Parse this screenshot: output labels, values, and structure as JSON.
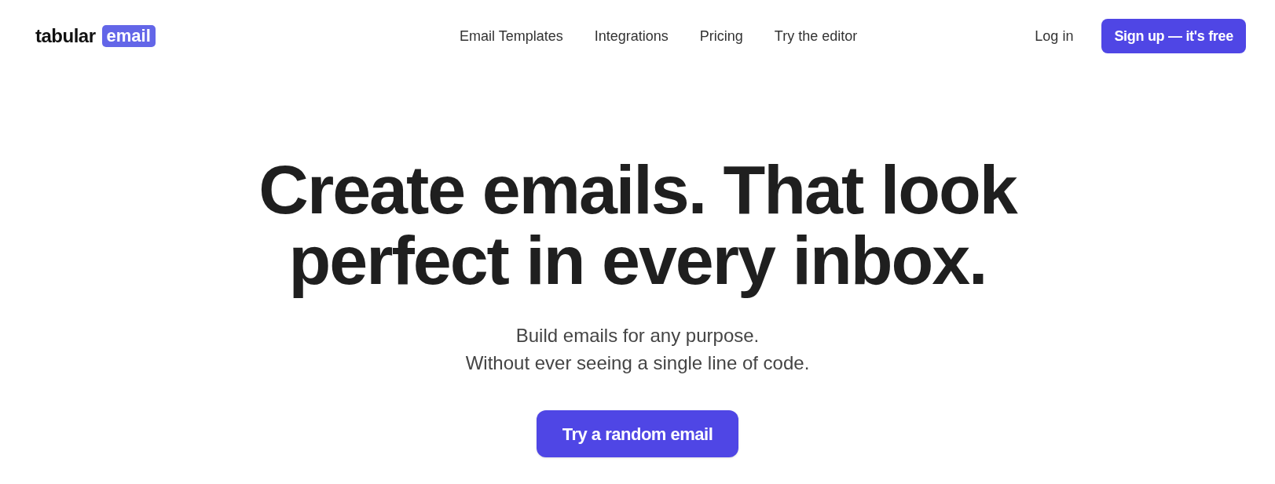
{
  "header": {
    "logo": {
      "word": "tabular",
      "badge": "email"
    },
    "nav": [
      "Email Templates",
      "Integrations",
      "Pricing",
      "Try the editor"
    ],
    "login": "Log in",
    "signup": "Sign up — it's free"
  },
  "hero": {
    "headline": [
      "Create emails. That look",
      "perfect in every inbox."
    ],
    "subtitle": [
      "Build emails for any purpose.",
      "Without ever seeing a single line of code."
    ],
    "cta": "Try a random email"
  }
}
